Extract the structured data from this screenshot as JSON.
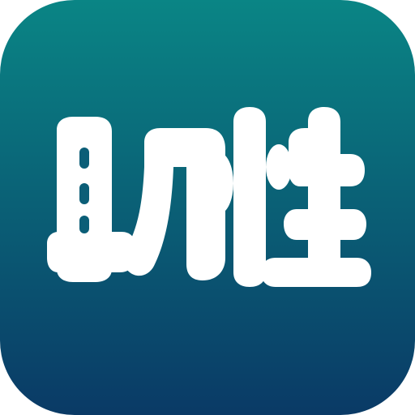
{
  "app_icon": {
    "text": "助性",
    "colors": {
      "gradient_top": "#0a8585",
      "gradient_bottom": "#0a3a66",
      "glyph": "#ffffff"
    }
  }
}
